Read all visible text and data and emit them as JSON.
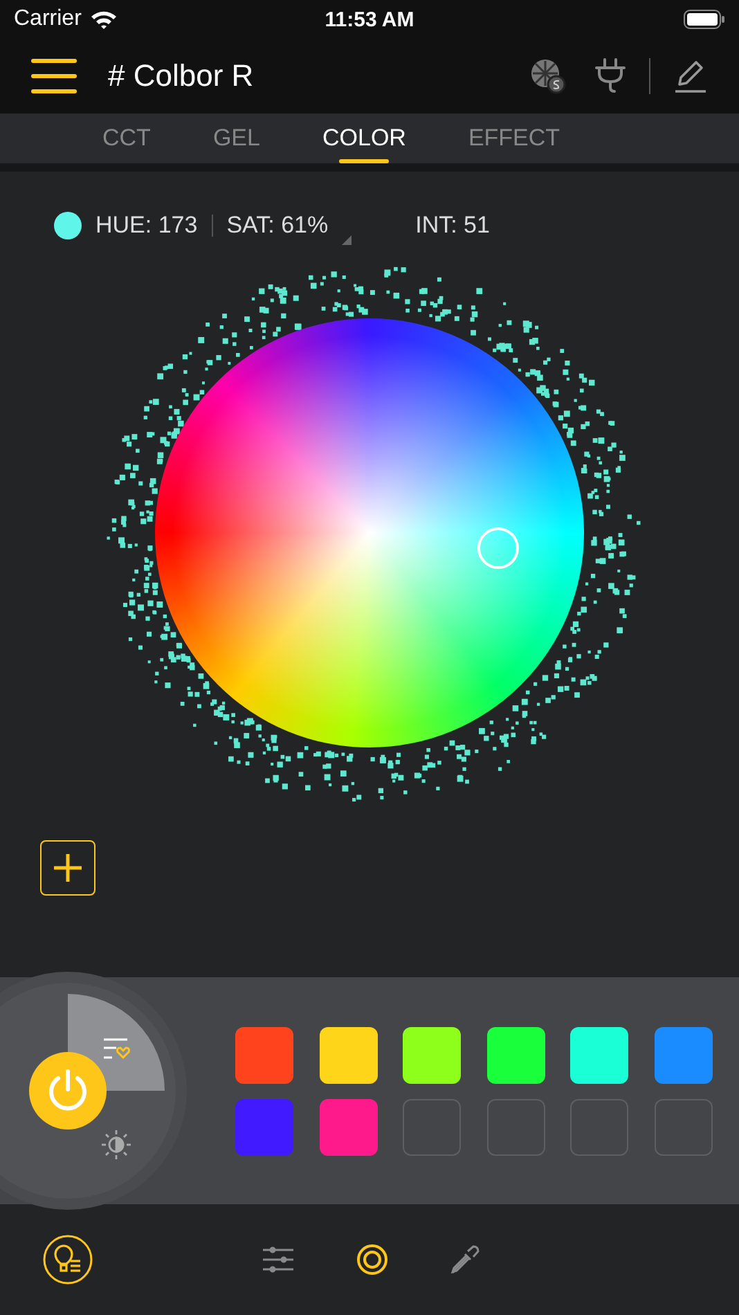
{
  "status_bar": {
    "carrier": "Carrier",
    "time": "11:53 AM"
  },
  "header": {
    "title": "# Colbor R"
  },
  "tabs": [
    {
      "label": "CCT",
      "selected": false
    },
    {
      "label": "GEL",
      "selected": false
    },
    {
      "label": "COLOR",
      "selected": true
    },
    {
      "label": "EFFECT",
      "selected": false
    }
  ],
  "readout": {
    "color": "#5ff5e8",
    "hue": "HUE: 173",
    "sat": "SAT: 61%",
    "int": "INT: 51"
  },
  "swatches": [
    {
      "kind": "color",
      "color": "#ff441d"
    },
    {
      "kind": "color",
      "color": "#ffd51a"
    },
    {
      "kind": "color",
      "color": "#8dff1a"
    },
    {
      "kind": "color",
      "color": "#1aff3c"
    },
    {
      "kind": "color",
      "color": "#1affd6"
    },
    {
      "kind": "color",
      "color": "#1a8cff"
    },
    {
      "kind": "color",
      "color": "#421aff"
    },
    {
      "kind": "color",
      "color": "#ff1a8c"
    },
    {
      "kind": "empty"
    },
    {
      "kind": "empty"
    },
    {
      "kind": "empty"
    },
    {
      "kind": "empty"
    }
  ],
  "bottom_nav": [
    {
      "kind": "sliders",
      "selected": false
    },
    {
      "kind": "rings",
      "selected": true
    },
    {
      "kind": "dropper",
      "selected": false
    }
  ]
}
